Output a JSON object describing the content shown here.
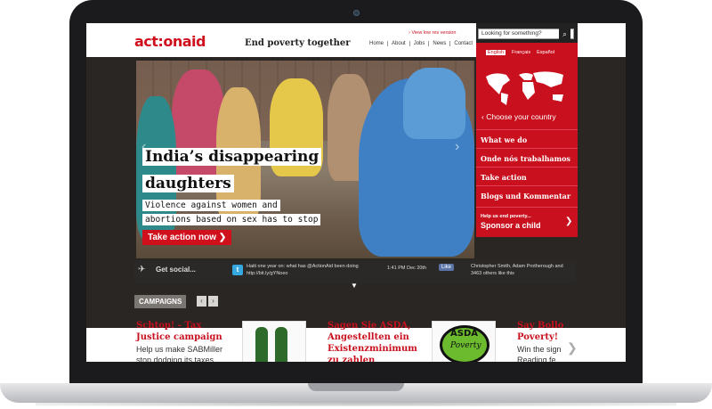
{
  "site": {
    "logo_text": "act:onaid",
    "tagline": "End poverty together",
    "low_res_link": "› View low res version",
    "nav": [
      "Home",
      "About",
      "Jobs",
      "News",
      "Contact"
    ],
    "search_placeholder": "Looking for something?",
    "languages": [
      "English",
      "Français",
      "Español"
    ],
    "choose_country": "Choose your country",
    "menu": [
      "What we do",
      "Onde nós trabalhamos",
      "Take action",
      "Blogs und Kommentar"
    ],
    "sponsor_small": "Help us end poverty...",
    "sponsor_label": "Sponsor a child"
  },
  "hero": {
    "headline_line1": "India’s disappearing",
    "headline_line2": "daughters",
    "sub_line1": "Violence against women and",
    "sub_line2": "abortions based on sex has to stop",
    "cta": "Take action now"
  },
  "social": {
    "label": "Get social...",
    "tweet": "Haiti one year on: what has @ActionAid been doing http://bit.ly/gYNoeo",
    "tweet_time": "1:41 PM Dec 20th",
    "like": "Like",
    "fb_text": "Christopher Smith, Adam Protherough and 3463 others like this"
  },
  "campaigns": {
    "tab_label": "CAMPAIGNS",
    "items": [
      {
        "title_l1": "Schtop! - Tax",
        "title_l2": "Justice campaign",
        "desc_l1": "Help us make SABMiller",
        "desc_l2": "stop dodging its taxes"
      },
      {
        "title_l1": "Sagen Sie ASDA,",
        "title_l2": "Angestellten ein",
        "title_l3": "Existenzminimum",
        "title_l4": "zu zahlen"
      },
      {
        "title_l1": "Say Bollo",
        "title_l2": "Poverty!",
        "desc_l1": "Win the sign",
        "desc_l2": "Reading fe"
      }
    ],
    "asda_logo_l1": "ASDA",
    "asda_logo_l2": "Poverty"
  }
}
